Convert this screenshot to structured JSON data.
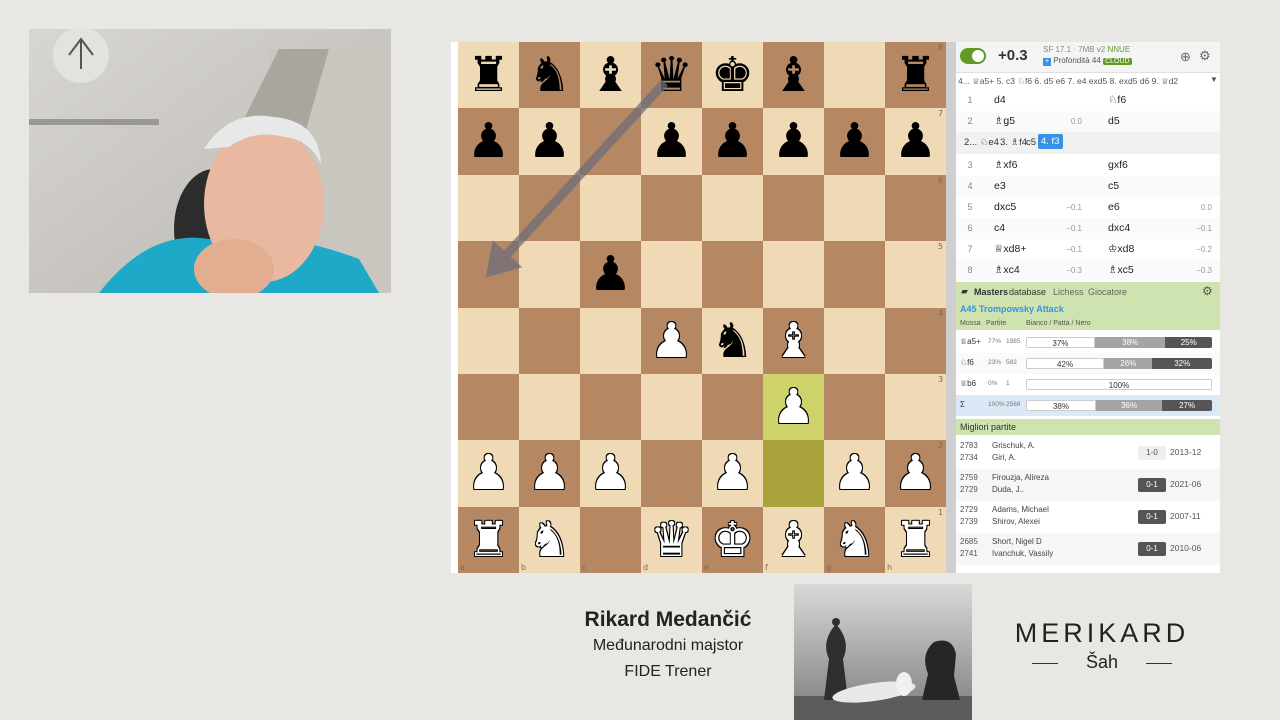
{
  "engine": {
    "toggle": "on",
    "eval": "+0.3",
    "engine_name": "SF 17.1 · 7MB v2",
    "nnue": "NNUE",
    "depth": "Profondità 44",
    "cloud": "CLOUD",
    "pv_line": "4... ♕a5+ 5. c3 ♘f6 6. d5 e6 7. e4 exd5 8. exd5 d6 9. ♕d2"
  },
  "moves_top": [
    {
      "num": "1",
      "white": "d4",
      "w_eval": "",
      "black": "♘f6",
      "b_eval": ""
    },
    {
      "num": "2",
      "white": "♗g5",
      "w_eval": "0.0",
      "black": "d5",
      "b_eval": ""
    }
  ],
  "variation": {
    "a": "2... ♘e4",
    "b": "3. ♗f4",
    "c": "c5",
    "d": "4. f3"
  },
  "moves_bottom": [
    {
      "num": "3",
      "white": "♗xf6",
      "w_eval": "",
      "black": "gxf6",
      "b_eval": ""
    },
    {
      "num": "4",
      "white": "e3",
      "w_eval": "",
      "black": "c5",
      "b_eval": ""
    },
    {
      "num": "5",
      "white": "dxc5",
      "w_eval": "−0.1",
      "black": "e6",
      "b_eval": "0.0"
    },
    {
      "num": "6",
      "white": "c4",
      "w_eval": "−0.1",
      "black": "dxc4",
      "b_eval": "−0.1"
    },
    {
      "num": "7",
      "white": "♕xd8+",
      "w_eval": "−0.1",
      "black": "♔xd8",
      "b_eval": "−0.2"
    },
    {
      "num": "8",
      "white": "♗xc4",
      "w_eval": "−0.3",
      "black": "♗xc5",
      "b_eval": "−0.3"
    }
  ],
  "explorer": {
    "tabs": [
      "Masters",
      "database",
      "Lichess",
      "Giocatore"
    ],
    "opening": "A45 Trompowsky Attack",
    "headers": [
      "Mossa",
      "Partite",
      "Bianco / Patta / Nero"
    ],
    "rows": [
      {
        "move": "♕a5+",
        "pct": "77%",
        "games": "1985",
        "w": 37,
        "d": 38,
        "b": 25,
        "wl": "37%",
        "dl": "38%",
        "bl": "25%"
      },
      {
        "move": "♘f6",
        "pct": "23%",
        "games": "582",
        "w": 42,
        "d": 26,
        "b": 32,
        "wl": "42%",
        "dl": "26%",
        "bl": "32%"
      },
      {
        "move": "♕b6",
        "pct": "0%",
        "games": "1",
        "w": 100,
        "d": 0,
        "b": 0,
        "wl": "100%",
        "dl": "",
        "bl": ""
      },
      {
        "move": "Σ",
        "pct": "100%",
        "games": "2568",
        "w": 38,
        "d": 36,
        "b": 27,
        "wl": "38%",
        "dl": "36%",
        "bl": "27%"
      }
    ],
    "best_games_title": "Migliori partite",
    "games": [
      {
        "r1": "2783",
        "r2": "2734",
        "p1": "Grischuk, A.",
        "p2": "Giri, A.",
        "result": "1-0",
        "light": true,
        "date": "2013-12"
      },
      {
        "r1": "2759",
        "r2": "2729",
        "p1": "Firouzja, Alireza",
        "p2": "Duda, J..",
        "result": "0-1",
        "light": false,
        "date": "2021-06"
      },
      {
        "r1": "2729",
        "r2": "2739",
        "p1": "Adams, Michael",
        "p2": "Shirov, Alexei",
        "result": "0-1",
        "light": false,
        "date": "2007-11"
      },
      {
        "r1": "2685",
        "r2": "2741",
        "p1": "Short, Nigel D",
        "p2": "Ivanchuk, Vassily",
        "result": "0-1",
        "light": false,
        "date": "2010-06"
      }
    ]
  },
  "caption": {
    "name": "Rikard Medančić",
    "title": "Međunarodni majstor",
    "role": "FIDE  Trener"
  },
  "brand": {
    "name": "MERIKARD",
    "sub": "Šah"
  },
  "board": {
    "files": [
      "a",
      "b",
      "c",
      "d",
      "e",
      "f",
      "g",
      "h"
    ],
    "ranks": [
      "8",
      "7",
      "6",
      "5",
      "4",
      "3",
      "2",
      "1"
    ],
    "position": [
      [
        "b:♜",
        "b:♞",
        "b:♝",
        "b:♛",
        "b:♚",
        "b:♝",
        "",
        "b:♜"
      ],
      [
        "b:♟",
        "b:♟",
        "",
        "b:♟",
        "b:♟",
        "b:♟",
        "b:♟",
        "b:♟"
      ],
      [
        "",
        "",
        "",
        "",
        "",
        "",
        "",
        ""
      ],
      [
        "",
        "",
        "b:♟",
        "",
        "",
        "",
        "",
        ""
      ],
      [
        "",
        "",
        "",
        "w:♟",
        "b:♞",
        "w:♝",
        "",
        ""
      ],
      [
        "",
        "",
        "",
        "",
        "",
        "w:♟",
        "",
        ""
      ],
      [
        "w:♟",
        "w:♟",
        "w:♟",
        "",
        "w:♟",
        "",
        "w:♟",
        "w:♟"
      ],
      [
        "w:♜",
        "w:♞",
        "",
        "w:♛",
        "w:♚",
        "w:♝",
        "w:♞",
        "w:♜"
      ]
    ],
    "last_move": [
      "f2",
      "f3"
    ],
    "arrow": [
      "d8",
      "a5"
    ]
  },
  "colors": {
    "green": "#cfe3b0",
    "accent": "#3692e7",
    "toggle": "#629924"
  }
}
